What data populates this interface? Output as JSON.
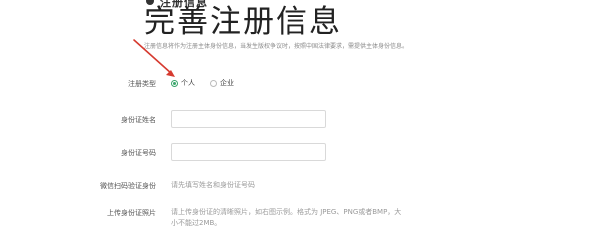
{
  "header": {
    "cut_text": "注册信息",
    "title": "完善注册信息",
    "description": "注册信息将作为注册主体身份信息，当发生版权争议时，按照中国法律要求，需提供主体身份信息。"
  },
  "form": {
    "reg_type": {
      "label": "注册类型",
      "options": [
        "个人",
        "企业"
      ],
      "selected": "个人"
    },
    "id_name": {
      "label": "身份证姓名",
      "value": "",
      "placeholder": ""
    },
    "id_number": {
      "label": "身份证号码",
      "value": "",
      "placeholder": ""
    },
    "wechat_verify": {
      "label": "微信扫码验证身份",
      "hint": "请先填写姓名和身份证号码"
    },
    "upload_id_photo": {
      "label": "上传身份证照片",
      "hint_line1": "请上传身份证的清晰照片，如右图示例。格式为 JPEG、PNG或者BMP，大",
      "hint_line2": "小不能过2MB。"
    }
  },
  "colors": {
    "accent": "#3aa56b",
    "annotation_arrow": "#d63a2f"
  }
}
